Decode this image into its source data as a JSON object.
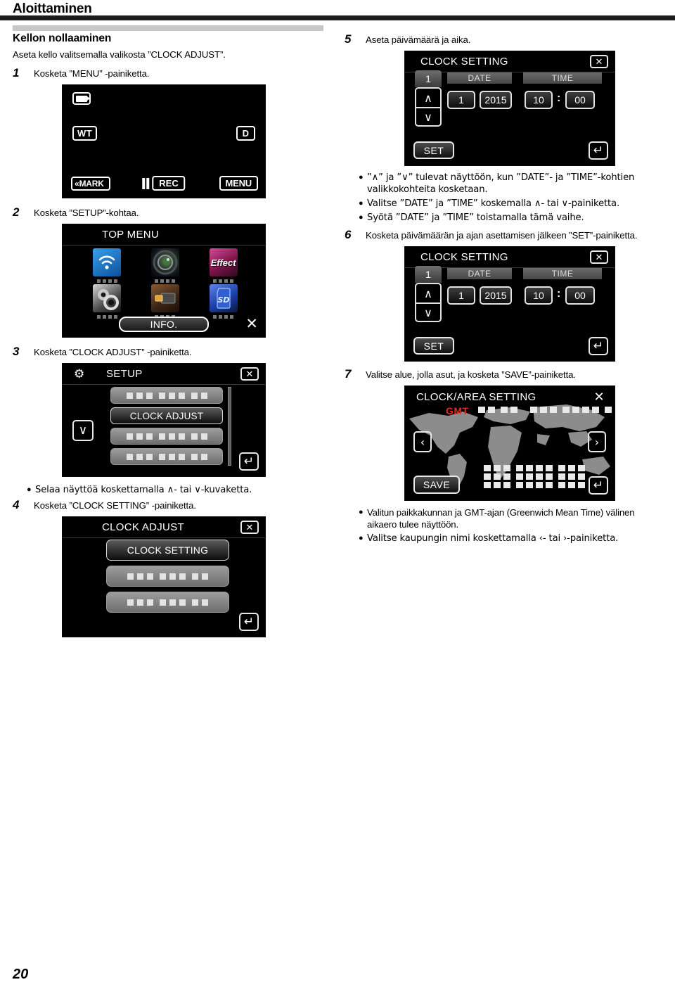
{
  "header": {
    "chapter": "Aloittaminen"
  },
  "section": {
    "title": "Kellon nollaaminen",
    "lead": "Aseta kello valitsemalla valikosta ”CLOCK ADJUST”."
  },
  "steps": {
    "s1": {
      "num": "1",
      "text": "Kosketa ”MENU” -painiketta."
    },
    "s2": {
      "num": "2",
      "text": "Kosketa ”SETUP”-kohtaa."
    },
    "s3": {
      "num": "3",
      "text": "Kosketa ”CLOCK ADJUST” -painiketta."
    },
    "s4": {
      "num": "4",
      "text": "Kosketa ”CLOCK SETTING” -painiketta."
    },
    "s5": {
      "num": "5",
      "text": "Aseta päivämäärä ja aika."
    },
    "s6": {
      "num": "6",
      "text": "Kosketa päivämäärän ja ajan asettamisen jälkeen ”SET”-painiketta."
    },
    "s7": {
      "num": "7",
      "text": "Valitse alue, jolla asut, ja kosketa ”SAVE”-painiketta."
    }
  },
  "bullets": {
    "b_scroll": "Selaa näyttöä koskettamalla ∧- tai ∨-kuvaketta.",
    "b_arrows": "”∧” ja ”∨” tulevat näyttöön, kun ”DATE”- ja ”TIME”-kohtien valikkokohteita kosketaan.",
    "b_select": "Valitse ”DATE” ja ”TIME” koskemalla ∧- tai ∨-painiketta.",
    "b_enter": "Syötä ”DATE” ja ”TIME” toistamalla tämä vaihe.",
    "b_gmt": "Valitun paikkakunnan ja GMT-ajan (Greenwich Mean Time) välinen aikaero tulee näyttöön.",
    "b_city": "Valitse kaupungin nimi koskettamalla ‹- tai ›-painiketta."
  },
  "screens": {
    "rec": {
      "wt": "WT",
      "d": "D",
      "mark": "«MARK",
      "rec": "REC",
      "menu": "MENU"
    },
    "top_menu": {
      "title": "TOP MENU",
      "info": "INFO.",
      "close": "✕",
      "icons": [
        {
          "name": "wifi-icon",
          "label": "",
          "color": "#1d6fc4"
        },
        {
          "name": "lens-icon",
          "label": "",
          "color": "#17181c"
        },
        {
          "name": "effect-icon",
          "label": "Effect",
          "color": "#a81e5e"
        },
        {
          "name": "gears-icon",
          "label": "",
          "color": "#2a2a2a"
        },
        {
          "name": "usb-icon",
          "label": "",
          "color": "#4a2d18"
        },
        {
          "name": "sd-card-icon",
          "label": "",
          "color": "#1b3fa8"
        }
      ]
    },
    "setup": {
      "title": "SETUP",
      "selected_item": "CLOCK ADJUST",
      "close": "✕",
      "down": "∨",
      "back": "↵"
    },
    "clock_adjust": {
      "title": "CLOCK ADJUST",
      "selected_item": "CLOCK SETTING",
      "close": "✕",
      "back": "↵"
    },
    "clock_setting": {
      "title": "CLOCK SETTING",
      "counter": "1",
      "date_label": "DATE",
      "time_label": "TIME",
      "day": "1",
      "year": "2015",
      "hour": "10",
      "colon": ":",
      "minute": "00",
      "set": "SET",
      "up": "∧",
      "down": "∨",
      "close": "✕",
      "back": "↵"
    },
    "clock_area": {
      "title": "CLOCK/AREA SETTING",
      "gmt": "GMT",
      "save": "SAVE",
      "prev": "‹",
      "next": "›",
      "close": "✕",
      "back": "↵"
    }
  },
  "footer": {
    "page_number": "20"
  }
}
